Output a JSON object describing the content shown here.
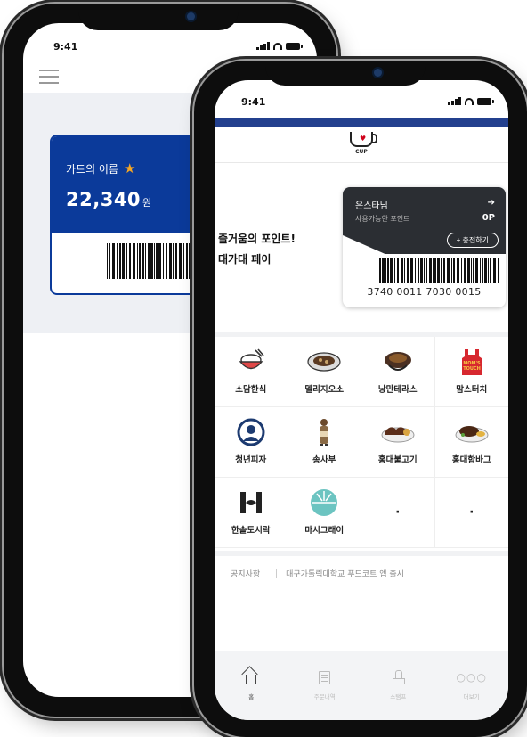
{
  "back_phone": {
    "status_time": "9:41",
    "card": {
      "name": "카드의 이름",
      "amount": "22,340",
      "currency_unit": "원"
    }
  },
  "front_phone": {
    "status_time": "9:41",
    "logo_text": "CUP",
    "slogan_line1": "즐거움의 포인트!",
    "slogan_line2": "대가대 페이",
    "pay_card": {
      "user": "은스타님",
      "points_label": "사용가능한 포인트",
      "points_value": "0P",
      "charge_button": "+ 충전하기",
      "card_number": "3740 0011 7030 0015"
    },
    "restaurants": [
      {
        "label": "소담한식",
        "icon": "rice-bowl-icon"
      },
      {
        "label": "델리지오소",
        "icon": "pasta-plate-icon"
      },
      {
        "label": "낭만테라스",
        "icon": "curry-bowl-icon"
      },
      {
        "label": "맘스터치",
        "icon": "moms-touch-logo-icon"
      },
      {
        "label": "청년피자",
        "icon": "pizza-chef-logo-icon"
      },
      {
        "label": "송사부",
        "icon": "bottle-mascot-icon"
      },
      {
        "label": "홍대불고기",
        "icon": "bulgogi-plate-icon"
      },
      {
        "label": "홍대함바그",
        "icon": "hamburg-steak-icon"
      },
      {
        "label": "한솥도시락",
        "icon": "hansot-logo-icon"
      },
      {
        "label": "마시그래이",
        "icon": "masigrae-logo-icon"
      },
      {
        "label": "·",
        "icon": ""
      },
      {
        "label": "·",
        "icon": ""
      }
    ],
    "notice": {
      "label": "공지사항",
      "text": "대구가톨릭대학교 푸드코트 앱 출시"
    },
    "tabs": [
      {
        "label": "홈",
        "icon": "home-icon",
        "active": true
      },
      {
        "label": "주문내역",
        "icon": "order-list-icon",
        "active": false
      },
      {
        "label": "스탬프",
        "icon": "stamp-icon",
        "active": false
      },
      {
        "label": "더보기",
        "icon": "more-icon",
        "active": false
      }
    ]
  },
  "colors": {
    "brand_blue": "#23408e",
    "card_blue": "#0b3a9a",
    "dark_card": "#2b2e33",
    "star": "#f5a623"
  }
}
